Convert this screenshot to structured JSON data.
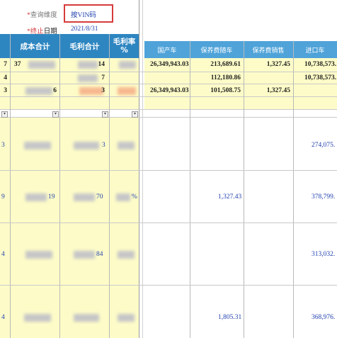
{
  "filter": {
    "query_dim_label": "查询维度",
    "query_dim_value": "按VIN码",
    "end_date_label_a": "终止",
    "end_date_label_b": "日期",
    "end_date_value": "2021/8/31",
    "asterisk": "*"
  },
  "left_headers": {
    "cost_total": "成本合计",
    "gross_profit_total": "毛利合计",
    "gross_margin": "毛利率",
    "pct": "%"
  },
  "right_headers": {
    "domestic": "国产车",
    "bonded_with": "保养费随车",
    "bonded_sales": "保养费销售",
    "imported": "进口车"
  },
  "summary_rows": [
    {
      "a": "7",
      "b": "37",
      "c": "14",
      "domestic": "26,349,943.03",
      "bonded_with": "213,689.61",
      "bonded_sales": "1,327.45",
      "imported": "10,738,573."
    },
    {
      "a": "4",
      "b": "",
      "c": "7",
      "domestic": "",
      "bonded_with": "112,180.86",
      "bonded_sales": "",
      "imported": "10,738,573."
    },
    {
      "a": "3",
      "b": "6",
      "c": "3",
      "domestic": "26,349,943.03",
      "bonded_with": "101,508.75",
      "bonded_sales": "1,327.45",
      "imported": ""
    }
  ],
  "detail_rows": [
    {
      "a": "3",
      "b": "",
      "c": "3",
      "bonded_with": "",
      "imported": "274,075."
    },
    {
      "a": "9",
      "b": "19",
      "c": "70",
      "pct": "%",
      "bonded_with": "1,327.43",
      "imported": "378,799."
    },
    {
      "a": "4",
      "b": "",
      "c": "84",
      "bonded_with": "",
      "imported": "313,032."
    },
    {
      "a": "4",
      "b": "",
      "c": "",
      "bonded_with": "1,805.31",
      "imported": "368,976."
    }
  ],
  "colors": {
    "header": "#2e86c1",
    "yellow": "#fdfcc8",
    "highlight_box": "#d63b3b",
    "blue_text": "#1f3fae"
  }
}
